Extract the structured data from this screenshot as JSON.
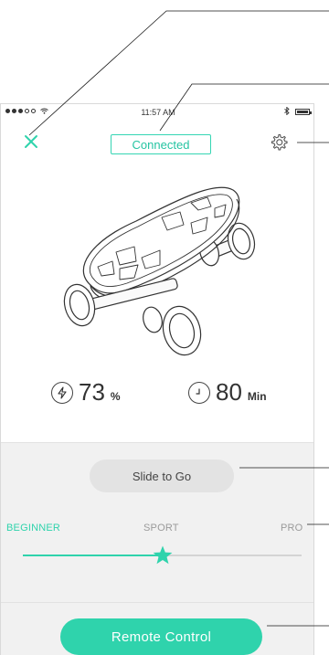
{
  "status_bar": {
    "time": "11:57 AM"
  },
  "header": {
    "connection_status": "Connected"
  },
  "stats": {
    "battery_value": "73",
    "battery_unit": "%",
    "time_value": "80",
    "time_unit": "Min"
  },
  "controls": {
    "slide_label": "Slide to Go",
    "modes": [
      "BEGINNER",
      "SPORT",
      "PRO"
    ],
    "selected_mode": "SPORT",
    "speed_level_fraction": 0.5,
    "remote_label": "Remote Control"
  },
  "icons": {
    "close": "close-icon",
    "settings": "gear-icon",
    "battery": "lightning-icon",
    "time": "clock-icon",
    "thumb": "star-icon"
  },
  "colors": {
    "accent": "#2fd3ac",
    "inactive_text": "#9a9a9a",
    "panel_bg": "#f1f1f1",
    "slide_button_bg": "#e3e3e3"
  }
}
